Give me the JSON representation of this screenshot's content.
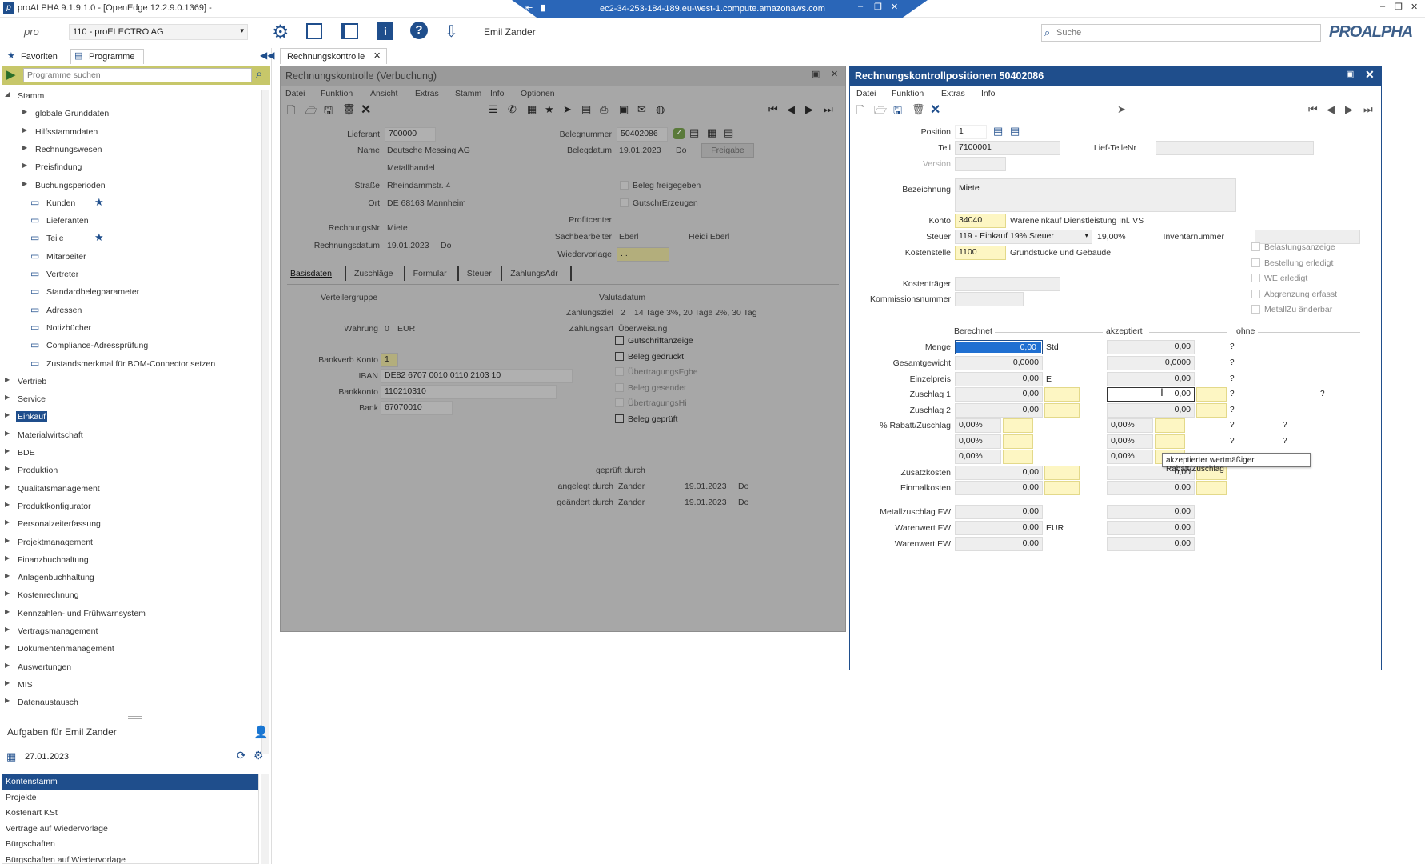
{
  "titlebar": {
    "title": "proALPHA 9.1.9.1.0 - [OpenEdge 12.2.9.0.1369] -",
    "remote": "ec2-34-253-184-189.eu-west-1.compute.amazonaws.com"
  },
  "toolbar": {
    "company": "110 - proELECTRO AG",
    "user": "Emil Zander",
    "search_placeholder": "Suche",
    "logo": "PROALPHA"
  },
  "nav": {
    "tab_favorites": "Favoriten",
    "tab_programs": "Programme",
    "search_placeholder": "Programme suchen",
    "tree": [
      {
        "label": "Stamm",
        "level": 0,
        "expanded": true
      },
      {
        "label": "globale Grunddaten",
        "level": 1
      },
      {
        "label": "Hilfsstammdaten",
        "level": 1
      },
      {
        "label": "Rechnungswesen",
        "level": 1
      },
      {
        "label": "Preisfindung",
        "level": 1
      },
      {
        "label": "Buchungsperioden",
        "level": 1
      },
      {
        "label": "Kunden",
        "level": 2,
        "star": true
      },
      {
        "label": "Lieferanten",
        "level": 2
      },
      {
        "label": "Teile",
        "level": 2,
        "star": true
      },
      {
        "label": "Mitarbeiter",
        "level": 2
      },
      {
        "label": "Vertreter",
        "level": 2
      },
      {
        "label": "Standardbelegparameter",
        "level": 2
      },
      {
        "label": "Adressen",
        "level": 2
      },
      {
        "label": "Notizbücher",
        "level": 2
      },
      {
        "label": "Compliance-Adressprüfung",
        "level": 2
      },
      {
        "label": "Zustandsmerkmal für BOM-Connector setzen",
        "level": 2
      },
      {
        "label": "Vertrieb",
        "level": 0
      },
      {
        "label": "Service",
        "level": 0
      },
      {
        "label": "Einkauf",
        "level": 0,
        "selected": true
      },
      {
        "label": "Materialwirtschaft",
        "level": 0
      },
      {
        "label": "BDE",
        "level": 0
      },
      {
        "label": "Produktion",
        "level": 0
      },
      {
        "label": "Qualitätsmanagement",
        "level": 0
      },
      {
        "label": "Produktkonfigurator",
        "level": 0
      },
      {
        "label": "Personalzeiterfassung",
        "level": 0
      },
      {
        "label": "Projektmanagement",
        "level": 0
      },
      {
        "label": "Finanzbuchhaltung",
        "level": 0
      },
      {
        "label": "Anlagenbuchhaltung",
        "level": 0
      },
      {
        "label": "Kostenrechnung",
        "level": 0
      },
      {
        "label": "Kennzahlen- und Frühwarnsystem",
        "level": 0
      },
      {
        "label": "Vertragsmanagement",
        "level": 0
      },
      {
        "label": "Dokumentenmanagement",
        "level": 0
      },
      {
        "label": "Auswertungen",
        "level": 0
      },
      {
        "label": "MIS",
        "level": 0
      },
      {
        "label": "Datenaustausch",
        "level": 0
      }
    ]
  },
  "tasks": {
    "title": "Aufgaben für Emil Zander",
    "date": "27.01.2023",
    "items": [
      "Kontenstamm",
      "Projekte",
      "Kostenart KSt",
      "Verträge auf Wiedervorlage",
      "Bürgschaften",
      "Bürgschaften auf Wiedervorlage"
    ]
  },
  "doc_tab": "Rechnungskontrolle",
  "rk": {
    "title": "Rechnungskontrolle (Verbuchung)",
    "menu": [
      "Datei",
      "Funktion",
      "Ansicht",
      "Extras",
      "Stamm",
      "Info",
      "Optionen"
    ],
    "lieferant_l": "Lieferant",
    "lieferant": "700000",
    "name_l": "Name",
    "name1": "Deutsche Messing AG",
    "name2": "Metallhandel",
    "strasse_l": "Straße",
    "strasse": "Rheindammstr. 4",
    "ort_l": "Ort",
    "ort": "DE 68163 Mannheim",
    "rnr_l": "RechnungsNr",
    "rnr": "Miete",
    "rdat_l": "Rechnungsdatum",
    "rdat": "19.01.2023",
    "rdat_day": "Do",
    "belegnr_l": "Belegnummer",
    "belegnr": "50402086",
    "belegdat_l": "Belegdatum",
    "belegdat": "19.01.2023",
    "belegdat_day": "Do",
    "freigabe_btn": "Freigabe",
    "cb_freigegeben": "Beleg freigegeben",
    "cb_gutschr": "GutschrErzeugen",
    "profitcenter_l": "Profitcenter",
    "sachb_l": "Sachbearbeiter",
    "sachb": "Eberl",
    "sachb_name": "Heidi Eberl",
    "wiedervorlage_l": "Wiedervorlage",
    "wiedervorlage": ". .",
    "tabs": [
      "Basisdaten",
      "Zuschläge",
      "Formular",
      "Steuer",
      "ZahlungsAdr"
    ],
    "verteiler_l": "Verteilergruppe",
    "waehrung_l": "Währung",
    "waehrung_code": "0",
    "waehrung": "EUR",
    "bankverb_l": "Bankverb Konto",
    "bankverb": "1",
    "iban_l": "IBAN",
    "iban": "DE82 6707 0010 0110 2103 10",
    "bankkonto_l": "Bankkonto",
    "bankkonto": "110210310",
    "bank_l": "Bank",
    "bank": "67070010",
    "valuta_l": "Valutadatum",
    "zahlziel_l": "Zahlungsziel",
    "zahlziel_code": "2",
    "zahlziel": "14 Tage 3%, 20 Tage 2%, 30 Tag",
    "zahlart_l": "Zahlungsart",
    "zahlart": "Überweisung",
    "checks": [
      "Gutschriftanzeige",
      "Beleg gedruckt",
      "ÜbertragungsFgbe",
      "Beleg gesendet",
      "ÜbertragungsHi",
      "Beleg geprüft"
    ],
    "geprueft_l": "geprüft durch",
    "angelegt_l": "angelegt durch",
    "angelegt_user": "Zander",
    "angelegt_date": "19.01.2023",
    "angelegt_day": "Do",
    "geaendert_l": "geändert durch",
    "geaendert_user": "Zander",
    "geaendert_date": "19.01.2023",
    "geaendert_day": "Do"
  },
  "rkp": {
    "title": "Rechnungskontrollpositionen 50402086",
    "menu": [
      "Datei",
      "Funktion",
      "Extras",
      "Info"
    ],
    "position_l": "Position",
    "position": "1",
    "teil_l": "Teil",
    "teil": "7100001",
    "lieftnr_l": "Lief-TeileNr",
    "version_l": "Version",
    "bez_l": "Bezeichnung",
    "bez": "Miete",
    "konto_l": "Konto",
    "konto": "34040",
    "konto_text": "Wareneinkauf Dienstleistung Inl. VS",
    "steuer_l": "Steuer",
    "steuer": "119 - Einkauf 19% Steuer",
    "steuer_pct": "19,00%",
    "kst_l": "Kostenstelle",
    "kst": "1100",
    "kst_text": "Grundstücke und Gebäude",
    "inventar_l": "Inventarnummer",
    "ktr_l": "Kostenträger",
    "komm_l": "Kommissionsnummer",
    "right_checks": [
      "Belastungsanzeige",
      "Bestellung erledigt",
      "WE erledigt",
      "Abgrenzung erfasst",
      "MetallZu änderbar"
    ],
    "col_berechnet": "Berechnet",
    "col_akzeptiert": "akzeptiert",
    "col_ohne": "ohne",
    "menge_l": "Menge",
    "menge": "0,00",
    "menge_unit": "Std",
    "menge_a": "0,00",
    "gewicht_l": "Gesamtgewicht",
    "gewicht": "0,0000",
    "gewicht_a": "0,0000",
    "ep_l": "Einzelpreis",
    "ep": "0,00",
    "ep_unit": "E",
    "ep_a": "0,00",
    "z1_l": "Zuschlag 1",
    "z1": "0,00",
    "z1_a": "0,00",
    "z2_l": "Zuschlag 2",
    "z2": "0,00",
    "z2_a": "0,00",
    "rabatt_l": "% Rabatt/Zuschlag",
    "rabatt": [
      "0,00%",
      "0,00%",
      "0,00%"
    ],
    "rabatt_a": [
      "0,00%",
      "0,00%",
      "0,00%"
    ],
    "zusatz_l": "Zusatzkosten",
    "zusatz": "0,00",
    "zusatz_a": "0,00",
    "einmal_l": "Einmalkosten",
    "einmal": "0,00",
    "einmal_a": "0,00",
    "metall_l": "Metallzuschlag FW",
    "metall": "0,00",
    "metall_a": "0,00",
    "wfw_l": "Warenwert FW",
    "wfw": "0,00",
    "wfw_unit": "EUR",
    "wfw_a": "0,00",
    "wew_l": "Warenwert EW",
    "wew": "0,00",
    "wew_a": "0,00",
    "q": "?",
    "tooltip": "akzeptierter wertmäßiger Rabatt/Zuschlag"
  }
}
